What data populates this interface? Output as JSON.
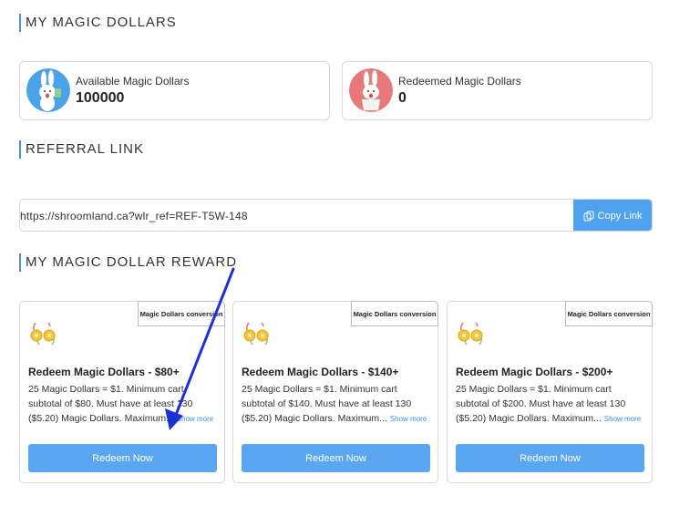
{
  "sections": {
    "magic_dollars_title": "MY MAGIC DOLLARS",
    "referral_title": "REFERRAL LINK",
    "reward_title": "MY MAGIC DOLLAR REWARD"
  },
  "stats": [
    {
      "label": "Available Magic Dollars",
      "value": "100000",
      "icon": "bunny-blue-avatar-icon",
      "color": "#4aa3e8"
    },
    {
      "label": "Redeemed Magic Dollars",
      "value": "0",
      "icon": "bunny-red-avatar-icon",
      "color": "#e8797a"
    }
  ],
  "referral": {
    "url": "https://shroomland.ca?wlr_ref=REF-T5W-148",
    "copy_label": "Copy Link"
  },
  "rewards": [
    {
      "tag": "Magic Dollars conversion",
      "title": "Redeem Magic Dollars - $80+",
      "desc_line1": "25 Magic Dollars = $1. Minimum cart",
      "desc_line2": "subtotal of $80. Must have at least 130",
      "desc_line3": "($5.20) Magic Dollars. Maximum...",
      "show_more": "Show more",
      "button": "Redeem Now"
    },
    {
      "tag": "Magic Dollars conversion",
      "title": "Redeem Magic Dollars - $140+",
      "desc_line1": "25 Magic Dollars = $1. Minimum cart",
      "desc_line2": "subtotal of $140. Must have at least 130",
      "desc_line3": "($5.20) Magic Dollars. Maximum...",
      "show_more": "Show more",
      "button": "Redeem Now"
    },
    {
      "tag": "Magic Dollars conversion",
      "title": "Redeem Magic Dollars - $200+",
      "desc_line1": "25 Magic Dollars = $1. Minimum cart",
      "desc_line2": "subtotal of $200. Must have at least 130",
      "desc_line3": "($5.20) Magic Dollars. Maximum...",
      "show_more": "Show more",
      "button": "Redeem Now"
    }
  ],
  "colors": {
    "accent": "#4fa2f0",
    "annotation_arrow": "#1d2fd6"
  }
}
